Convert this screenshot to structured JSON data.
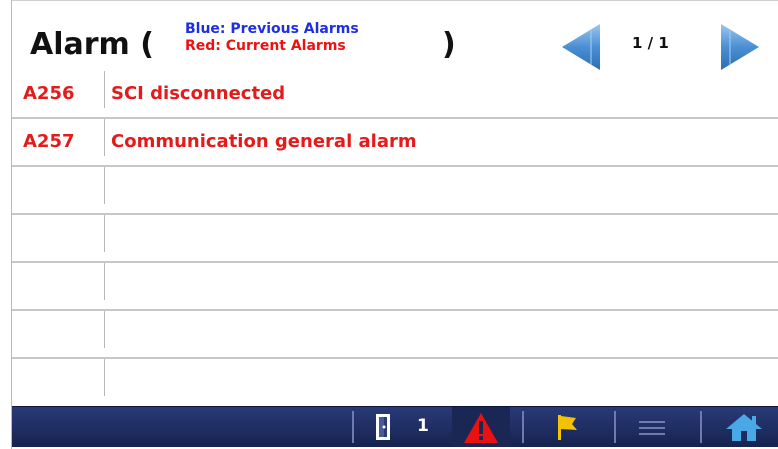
{
  "header": {
    "title": "Alarm (",
    "close_paren": ")",
    "legend_blue": "Blue: Previous Alarms",
    "legend_red": "Red: Current Alarms",
    "page_indicator": "1 / 1"
  },
  "alarms": [
    {
      "code": "A256",
      "description": "SCI disconnected",
      "color": "#e31b1b"
    },
    {
      "code": "A257",
      "description": "Communication general alarm",
      "color": "#e31b1b"
    },
    {
      "code": "",
      "description": ""
    },
    {
      "code": "",
      "description": ""
    },
    {
      "code": "",
      "description": ""
    },
    {
      "code": "",
      "description": ""
    },
    {
      "code": "",
      "description": ""
    }
  ],
  "statusbar": {
    "count": "1",
    "icons": [
      "door-icon",
      "alarm-warning-icon",
      "flag-icon",
      "menu-icon",
      "home-icon"
    ]
  },
  "colors": {
    "previous_alarm": "#1f2fe0",
    "current_alarm": "#ee1111",
    "nav_arrow": "#4a8fd4",
    "statusbar": "#1c2a5f"
  }
}
